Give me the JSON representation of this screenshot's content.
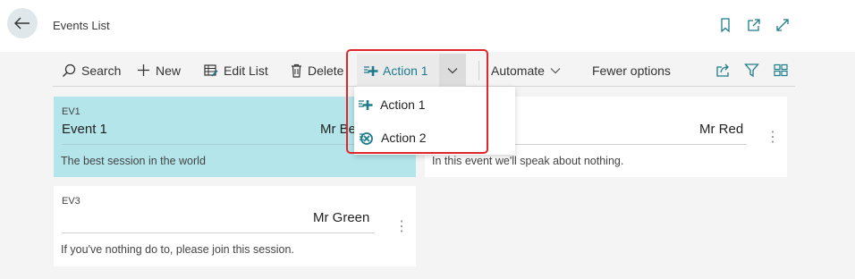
{
  "window": {
    "title": "Events List"
  },
  "toolbar": {
    "search_label": "Search",
    "new_label": "New",
    "edit_list_label": "Edit List",
    "delete_label": "Delete",
    "action1_label": "Action 1",
    "automate_label": "Automate",
    "fewer_options_label": "Fewer options"
  },
  "dropdown": {
    "items": [
      {
        "label": "Action 1",
        "icon": "add-action-icon"
      },
      {
        "label": "Action 2",
        "icon": "remove-action-icon"
      }
    ]
  },
  "cards": [
    {
      "code": "EV1",
      "name": "Event 1",
      "person": "Mr Be",
      "description": "The best session in the world",
      "selected": true
    },
    {
      "code": "",
      "name": "",
      "person": "Mr Red",
      "description": "In this event we'll speak about nothing.",
      "selected": false
    },
    {
      "code": "EV3",
      "name": "",
      "person": "Mr Green",
      "description": "If you've nothing do to, please join this session.",
      "selected": false
    }
  ],
  "colors": {
    "accent": "#1d7c8c",
    "selected_card": "#b3e5ea",
    "highlight_box": "#e0252b"
  }
}
